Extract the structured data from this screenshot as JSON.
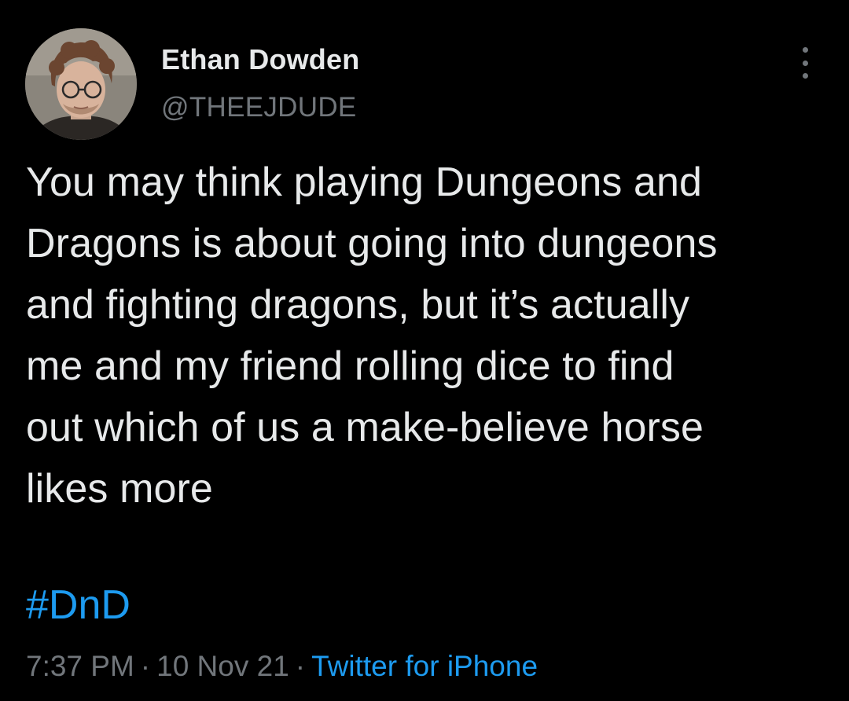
{
  "author": {
    "display_name": "Ethan Dowden",
    "handle": "@THEEJDUDE",
    "avatar_icon": "profile-photo"
  },
  "tweet": {
    "text": "You may think playing Dungeons and\nDragons is about going into dungeons\nand fighting dragons, but it’s actually\nme and my friend rolling dice to find\nout which of us a make-believe horse\nlikes more",
    "hashtag": "#DnD",
    "time": "7:37 PM",
    "separator": "·",
    "date": "10 Nov 21",
    "source": "Twitter for iPhone"
  },
  "menu": {
    "icon": "more-vertical-icon"
  },
  "colors": {
    "background": "#000000",
    "primary_text": "#e7e9ea",
    "secondary_text": "#71767b",
    "link": "#1d9bf0"
  }
}
